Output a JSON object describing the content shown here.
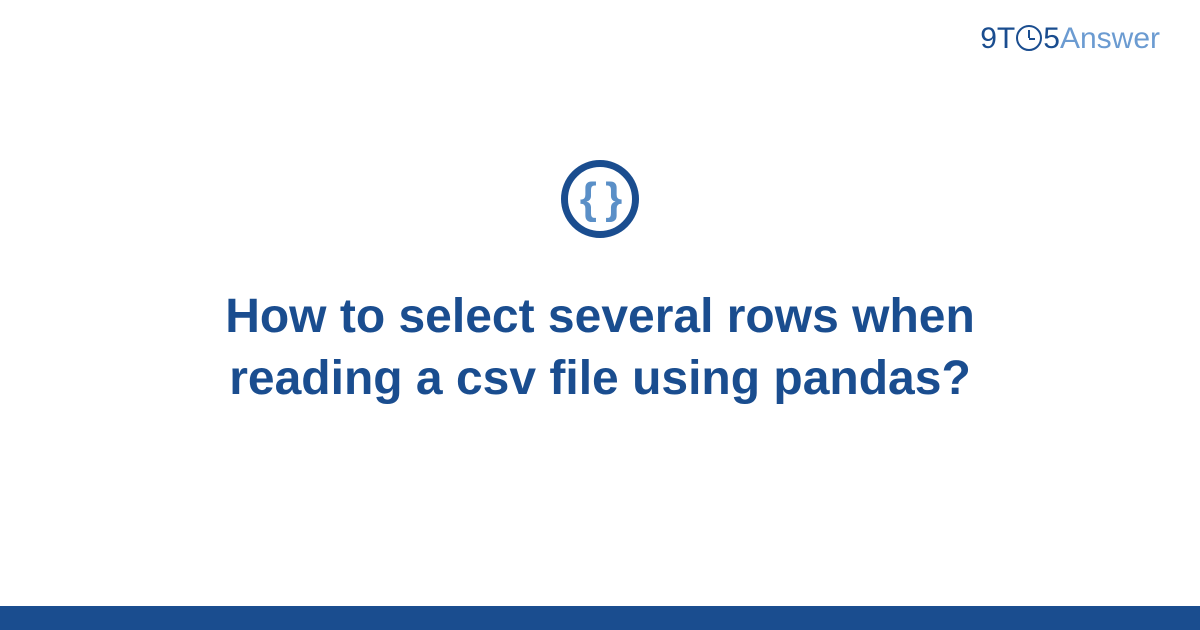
{
  "logo": {
    "part1": "9T",
    "part2": "5",
    "part3": "Answer"
  },
  "icon": {
    "glyph": "{ }",
    "name": "code-braces-icon"
  },
  "title": "How to select several rows when reading a csv file using pandas?",
  "colors": {
    "primary": "#1a4d8f",
    "secondary": "#6b9bd1",
    "icon_glyph": "#5a8fc7"
  }
}
